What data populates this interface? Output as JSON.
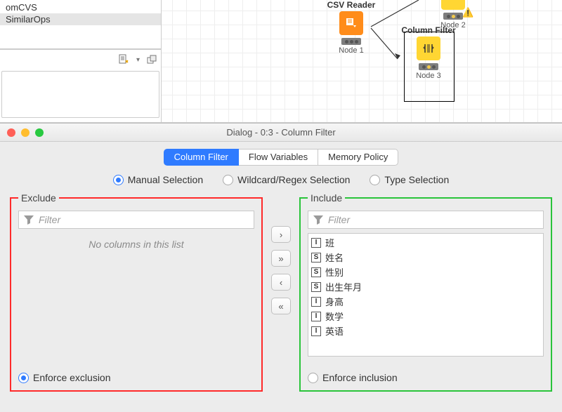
{
  "tree": {
    "items": [
      "omCVS",
      "SimilarOps"
    ],
    "selected_index": 1
  },
  "canvas": {
    "csv_reader": {
      "title": "CSV Reader",
      "caption": "Node 1"
    },
    "column_filter": {
      "title": "Column Filter",
      "caption": "Node 3"
    },
    "node2": {
      "caption": "Node 2"
    }
  },
  "dialog": {
    "title": "Dialog - 0:3 - Column Filter",
    "tabs": [
      "Column Filter",
      "Flow Variables",
      "Memory Policy"
    ],
    "active_tab_index": 0,
    "modes": [
      "Manual Selection",
      "Wildcard/Regex Selection",
      "Type Selection"
    ],
    "selected_mode_index": 0,
    "exclude": {
      "legend": "Exclude",
      "filter_placeholder": "Filter",
      "empty_message": "No columns in this list",
      "enforce_label": "Enforce exclusion",
      "enforce_selected": true
    },
    "include": {
      "legend": "Include",
      "filter_placeholder": "Filter",
      "columns": [
        {
          "type": "I",
          "name": "班"
        },
        {
          "type": "S",
          "name": "姓名"
        },
        {
          "type": "S",
          "name": "性别"
        },
        {
          "type": "S",
          "name": "出生年月"
        },
        {
          "type": "I",
          "name": "身高"
        },
        {
          "type": "I",
          "name": "数学"
        },
        {
          "type": "I",
          "name": "英语"
        }
      ],
      "enforce_label": "Enforce inclusion",
      "enforce_selected": false
    },
    "mover": {
      "right": "›",
      "all_right": "»",
      "left": "‹",
      "all_left": "«"
    }
  }
}
